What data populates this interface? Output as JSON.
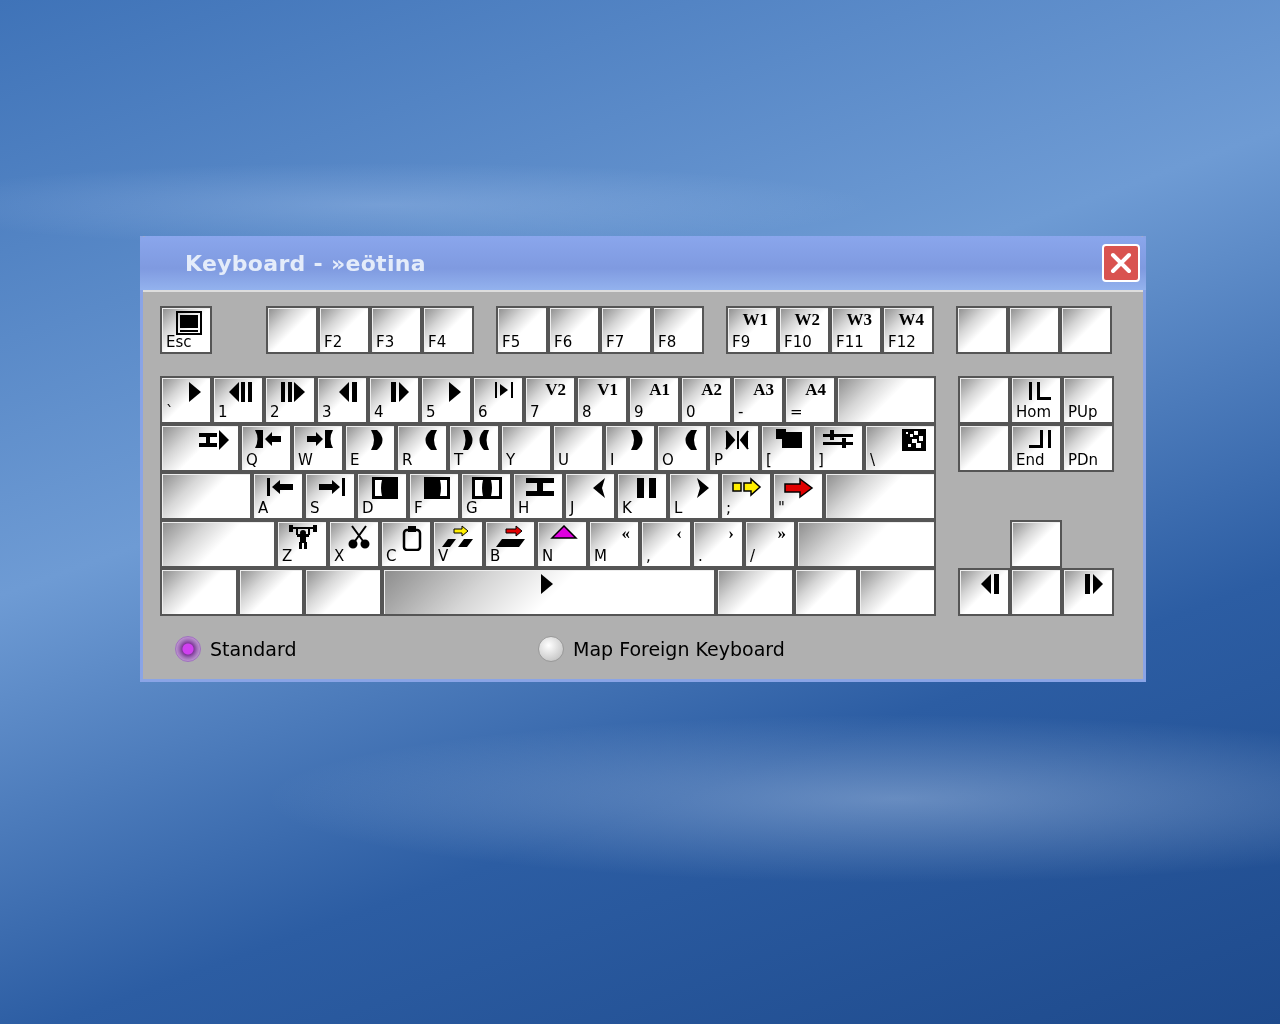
{
  "window": {
    "title": "Keyboard - »eötina"
  },
  "function_keys": [
    [
      {
        "label": "Esc",
        "kind": "monitor"
      }
    ],
    [
      {
        "kind": "blank"
      },
      {
        "label": "F2",
        "kind": "blank"
      },
      {
        "label": "F3",
        "kind": "blank"
      },
      {
        "label": "F4",
        "kind": "blank"
      }
    ],
    [
      {
        "label": "F5",
        "kind": "blank"
      },
      {
        "label": "F6",
        "kind": "blank"
      },
      {
        "label": "F7",
        "kind": "blank"
      },
      {
        "label": "F8",
        "kind": "blank"
      }
    ],
    [
      {
        "label": "F9",
        "legend": "W1",
        "kind": "blank"
      },
      {
        "label": "F10",
        "legend": "W2",
        "kind": "blank"
      },
      {
        "label": "F11",
        "legend": "W3",
        "kind": "blank"
      },
      {
        "label": "F12",
        "legend": "W4",
        "kind": "blank"
      }
    ],
    [
      {
        "kind": "blank"
      },
      {
        "kind": "blank"
      },
      {
        "kind": "blank"
      }
    ]
  ],
  "main_keys": [
    [
      {
        "label": "`",
        "kind": "play"
      },
      {
        "label": "1",
        "kind": "rewind-bars"
      },
      {
        "label": "2",
        "kind": "bars-play"
      },
      {
        "label": "3",
        "kind": "step-back"
      },
      {
        "label": "4",
        "kind": "step-forward"
      },
      {
        "label": "5",
        "kind": "play"
      },
      {
        "label": "6",
        "kind": "skip-end"
      },
      {
        "label": "7",
        "legend": "V2",
        "kind": "blank"
      },
      {
        "label": "8",
        "legend": "V1",
        "kind": "blank"
      },
      {
        "label": "9",
        "legend": "A1",
        "kind": "blank"
      },
      {
        "label": "0",
        "legend": "A2",
        "kind": "blank"
      },
      {
        "label": "-",
        "legend": "A3",
        "kind": "blank"
      },
      {
        "label": "=",
        "legend": "A4",
        "kind": "blank"
      },
      {
        "kind": "blank"
      }
    ],
    [
      {
        "kind": "film-play"
      },
      {
        "label": "Q",
        "kind": "bracket-left-arrow"
      },
      {
        "label": "W",
        "kind": "arrow-bracket"
      },
      {
        "label": "E",
        "kind": "half-moon-right"
      },
      {
        "label": "R",
        "kind": "half-moon-left"
      },
      {
        "label": "T",
        "kind": "double-moon"
      },
      {
        "label": "Y",
        "kind": "blank"
      },
      {
        "label": "U",
        "kind": "blank"
      },
      {
        "label": "I",
        "kind": "half-moon-right"
      },
      {
        "label": "O",
        "kind": "half-moon-left"
      },
      {
        "label": "P",
        "kind": "thin-brackets"
      },
      {
        "label": "[",
        "kind": "window"
      },
      {
        "label": "]",
        "kind": "sliders"
      },
      {
        "label": "\\",
        "kind": "dither-square"
      }
    ],
    [
      {
        "kind": "blank"
      },
      {
        "label": "A",
        "kind": "bar-left-arrow"
      },
      {
        "label": "S",
        "kind": "arrow-bar-right"
      },
      {
        "label": "D",
        "kind": "bracket-frame"
      },
      {
        "label": "F",
        "kind": "frame-bracket"
      },
      {
        "label": "G",
        "kind": "double-frame"
      },
      {
        "label": "H",
        "kind": "film"
      },
      {
        "label": "J",
        "kind": "small-left-triangle"
      },
      {
        "label": "K",
        "kind": "pause"
      },
      {
        "label": "L",
        "kind": "small-right-triangle"
      },
      {
        "label": ";",
        "kind": "outline-arrow"
      },
      {
        "label": "\"",
        "kind": "solid-arrow"
      },
      {
        "kind": "blank"
      }
    ],
    [
      {
        "kind": "blank"
      },
      {
        "label": "Z",
        "kind": "weightlifter"
      },
      {
        "label": "X",
        "kind": "scissors"
      },
      {
        "label": "C",
        "kind": "clipboard"
      },
      {
        "label": "V",
        "kind": "arrow-over-steps"
      },
      {
        "label": "B",
        "kind": "arrow-over-bar"
      },
      {
        "label": "N",
        "kind": "triangle"
      },
      {
        "label": "M",
        "legend": "«",
        "kind": "blank"
      },
      {
        "label": ",",
        "legend": "‹",
        "kind": "blank"
      },
      {
        "label": ".",
        "legend": "›",
        "kind": "blank"
      },
      {
        "label": "/",
        "legend": "»",
        "kind": "blank"
      },
      {
        "kind": "blank"
      }
    ],
    [
      {
        "kind": "blank"
      },
      {
        "kind": "blank"
      },
      {
        "kind": "blank"
      },
      {
        "kind": "play"
      },
      {
        "kind": "blank"
      },
      {
        "kind": "blank"
      },
      {
        "kind": "blank"
      }
    ]
  ],
  "navigation_keys": [
    [
      {
        "kind": "blank"
      },
      {
        "label": "Hom",
        "kind": "corner-home"
      },
      {
        "label": "PUp",
        "kind": "blank"
      }
    ],
    [
      {
        "kind": "blank"
      },
      {
        "label": "End",
        "kind": "corner-end"
      },
      {
        "label": "PDn",
        "kind": "blank"
      }
    ]
  ],
  "arrow_keys": [
    [
      {
        "kind": "blank"
      }
    ],
    [
      {
        "kind": "step-back"
      },
      {
        "kind": "blank"
      },
      {
        "kind": "step-forward"
      }
    ]
  ],
  "modes": [
    {
      "label": "Standard",
      "selected": true
    },
    {
      "label": "Map Foreign Keyboard",
      "selected": false
    }
  ]
}
